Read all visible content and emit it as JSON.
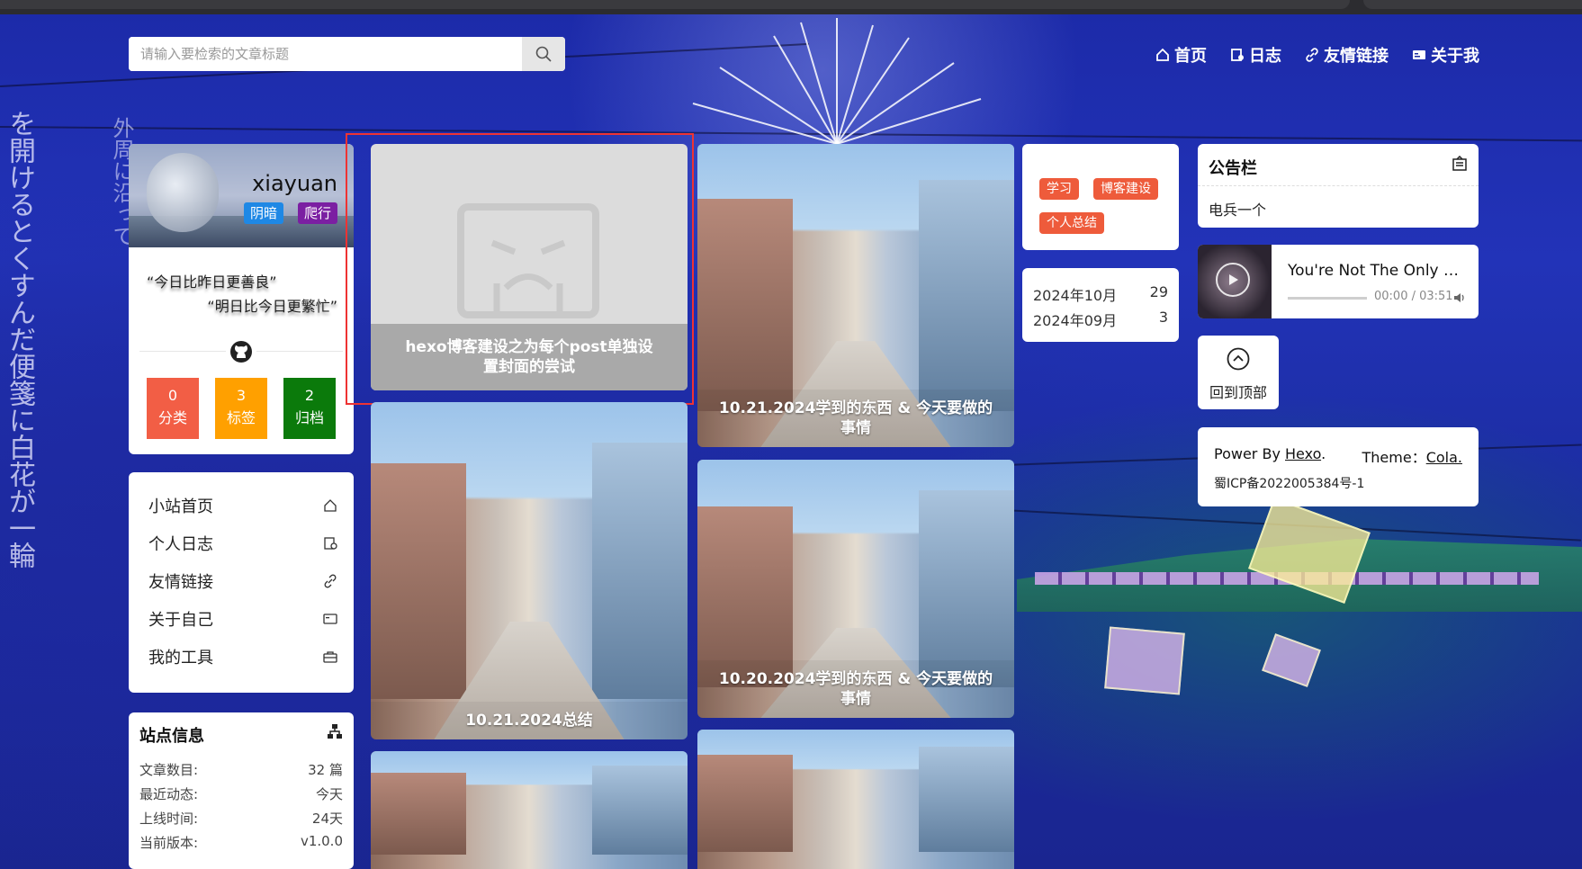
{
  "search": {
    "placeholder": "请输入要检索的文章标题"
  },
  "nav": {
    "items": [
      {
        "label": "首页",
        "icon": "home-icon"
      },
      {
        "label": "日志",
        "icon": "journal-icon"
      },
      {
        "label": "友情链接",
        "icon": "link-icon"
      },
      {
        "label": "关于我",
        "icon": "id-card-icon"
      }
    ]
  },
  "profile": {
    "name": "xiayuan",
    "tags": [
      {
        "label": "阴暗",
        "color": "#1e88e5"
      },
      {
        "label": "爬行",
        "color": "#7b1fa2"
      }
    ],
    "quote1": "“今日比昨日更善良”",
    "quote2": "“明日比今日更繁忙”",
    "stats": [
      {
        "num": "0",
        "label": "分类",
        "color": "#f25e45"
      },
      {
        "num": "3",
        "label": "标签",
        "color": "#ffa000"
      },
      {
        "num": "2",
        "label": "归档",
        "color": "#0b7a0b"
      }
    ]
  },
  "menu": {
    "items": [
      {
        "label": "小站首页",
        "icon": "home-icon"
      },
      {
        "label": "个人日志",
        "icon": "journal-icon"
      },
      {
        "label": "友情链接",
        "icon": "link-icon"
      },
      {
        "label": "关于自己",
        "icon": "id-card-icon"
      },
      {
        "label": "我的工具",
        "icon": "toolbox-icon"
      }
    ]
  },
  "site_info": {
    "title": "站点信息",
    "rows": [
      {
        "label": "文章数目:",
        "value": "32 篇"
      },
      {
        "label": "最近动态:",
        "value": "今天"
      },
      {
        "label": "上线时间:",
        "value": "24天"
      },
      {
        "label": "当前版本:",
        "value": "v1.0.0"
      }
    ]
  },
  "posts": [
    {
      "title": "hexo博客建设之为每个post单独设置封面的尝试"
    },
    {
      "title": "10.21.2024学到的东西 & 今天要做的事情"
    },
    {
      "title": "10.21.2024总结"
    },
    {
      "title": "10.20.2024学到的东西 & 今天要做的事情"
    }
  ],
  "tags_widget": {
    "tags": [
      "学习",
      "博客建设",
      "个人总结"
    ]
  },
  "archives": [
    {
      "month": "2024年10月",
      "count": "29"
    },
    {
      "month": "2024年09月",
      "count": "3"
    }
  ],
  "notice": {
    "title": "公告栏",
    "body": "电兵一个"
  },
  "player": {
    "song": "You're Not The Only One",
    "time": "00:00 / 03:51"
  },
  "totop": {
    "label": "回到顶部"
  },
  "footer": {
    "power_by": "Power By",
    "hexo": "Hexo",
    "theme": "Theme：",
    "cola": "Cola.",
    "icp": "蜀ICP备2022005384号-1"
  }
}
